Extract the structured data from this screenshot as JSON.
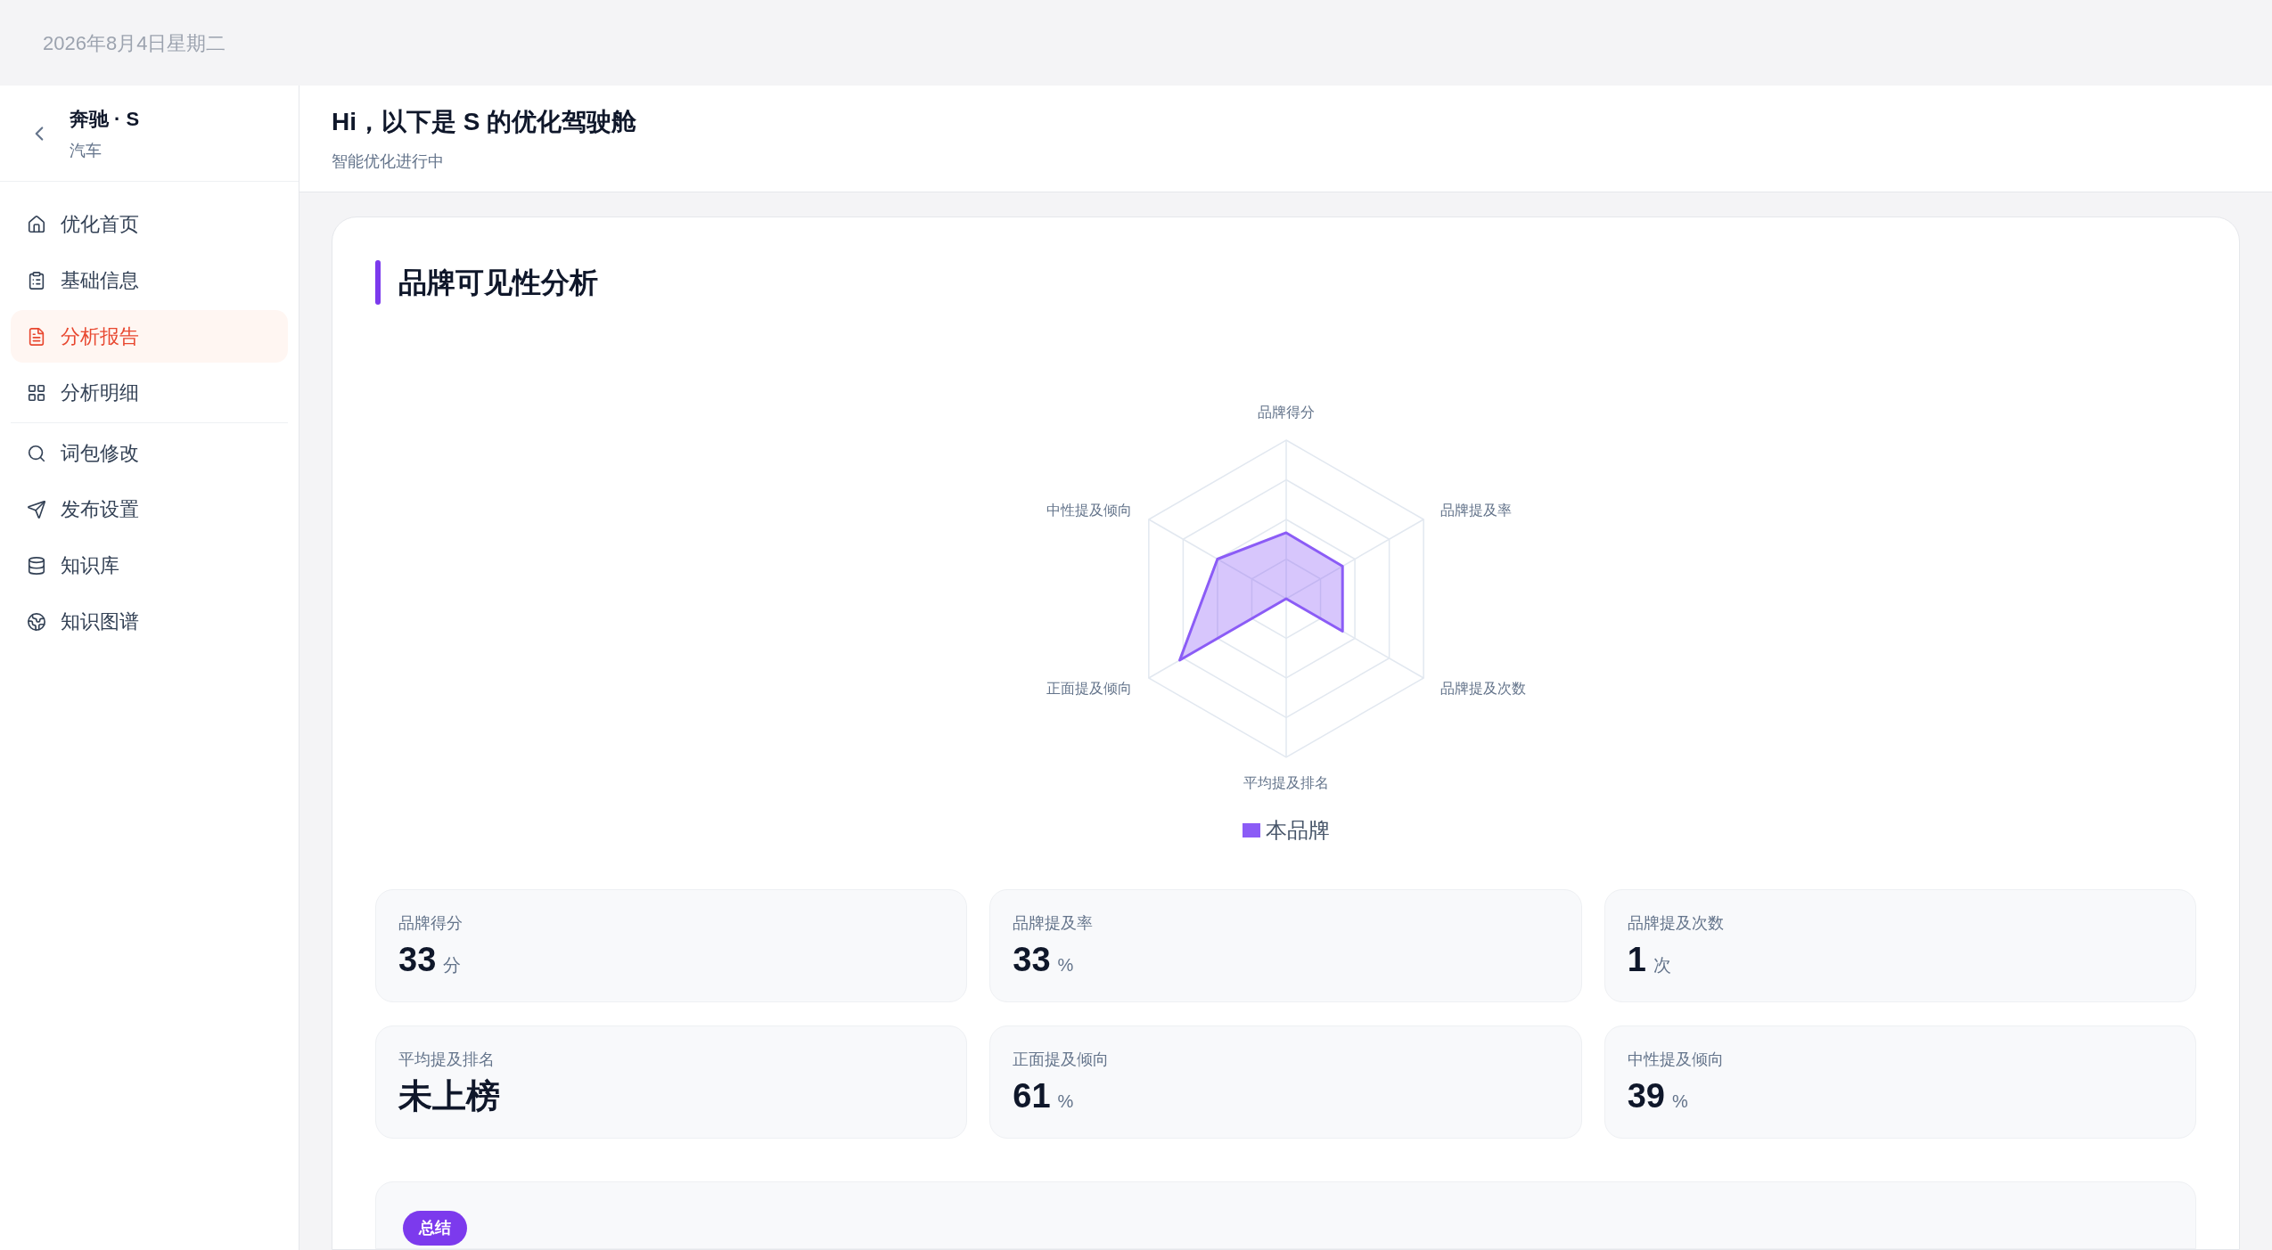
{
  "top_bar": {
    "date": "2026年8月4日星期二"
  },
  "sidebar": {
    "brand": "奔驰 · S",
    "category": "汽车",
    "nav_groups": [
      [
        {
          "label": "优化首页",
          "selected": false
        },
        {
          "label": "基础信息",
          "selected": false
        },
        {
          "label": "分析报告",
          "selected": true
        },
        {
          "label": "分析明细",
          "selected": false
        }
      ],
      [
        {
          "label": "词包修改",
          "selected": false
        },
        {
          "label": "发布设置",
          "selected": false
        },
        {
          "label": "知识库",
          "selected": false
        },
        {
          "label": "知识图谱",
          "selected": false
        }
      ]
    ]
  },
  "header": {
    "title": "Hi，以下是 S 的优化驾驶舱",
    "subtitle": "智能优化进行中"
  },
  "section": {
    "title": "品牌可见性分析",
    "radar": {
      "axes": [
        "品牌得分",
        "品牌提及率",
        "品牌提及次数",
        "平均提及排名",
        "正面提及倾向",
        "中性提及倾向"
      ],
      "legend": "本品牌"
    },
    "stats": [
      {
        "label": "品牌得分",
        "value": "33",
        "unit": "分"
      },
      {
        "label": "品牌提及率",
        "value": "33",
        "unit": "%"
      },
      {
        "label": "品牌提及次数",
        "value": "1",
        "unit": "次"
      },
      {
        "label": "平均提及排名",
        "value": "未上榜"
      },
      {
        "label": "正面提及倾向",
        "value": "61",
        "unit": "%"
      },
      {
        "label": "中性提及倾向",
        "value": "39",
        "unit": "%"
      }
    ]
  },
  "summary": {
    "badge": "总结"
  }
}
